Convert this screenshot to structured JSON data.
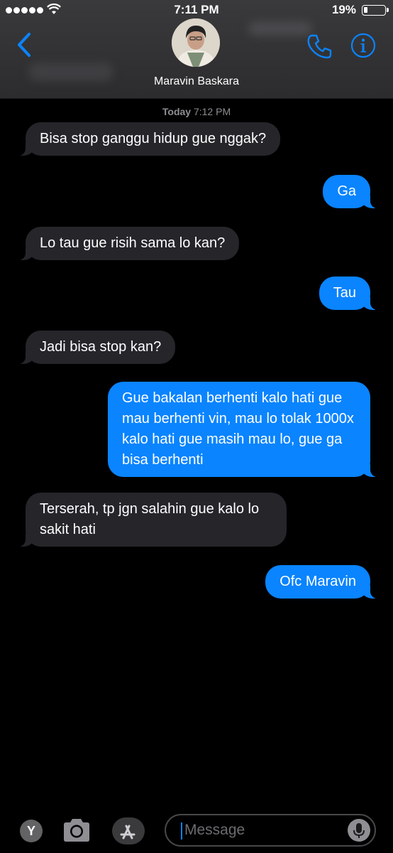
{
  "status_bar": {
    "time": "7:11 PM",
    "battery_percent": "19%",
    "battery_level": 0.19,
    "signal_bars": 5
  },
  "header": {
    "contact_name": "Maravin Baskara",
    "back_icon": "chevron-left-icon",
    "call_icon": "phone-icon",
    "info_icon": "info-icon"
  },
  "thread": {
    "timestamp_day": "Today",
    "timestamp_time": "7:12 PM",
    "messages": [
      {
        "direction": "in",
        "text": "Bisa stop ganggu hidup gue nggak?"
      },
      {
        "direction": "out",
        "text": "Ga"
      },
      {
        "direction": "in",
        "text": "Lo tau gue risih sama lo kan?"
      },
      {
        "direction": "out",
        "text": "Tau"
      },
      {
        "direction": "in",
        "text": "Jadi bisa stop kan?"
      },
      {
        "direction": "out",
        "text": "Gue bakalan berhenti kalo hati gue mau berhenti vin, mau lo tolak 1000x kalo hati gue masih mau lo, gue ga bisa berhenti"
      },
      {
        "direction": "in",
        "text": "Terserah, tp jgn salahin gue kalo lo sakit hati"
      },
      {
        "direction": "out",
        "text": "Ofc Maravin"
      }
    ]
  },
  "input_bar": {
    "y_app_label": "Y",
    "placeholder": "Message",
    "camera_icon": "camera-icon",
    "appstore_icon": "app-store-icon",
    "mic_icon": "microphone-icon"
  },
  "colors": {
    "incoming_bubble": "#26252a",
    "outgoing_bubble": "#0a84ff",
    "accent": "#0a84ff"
  }
}
